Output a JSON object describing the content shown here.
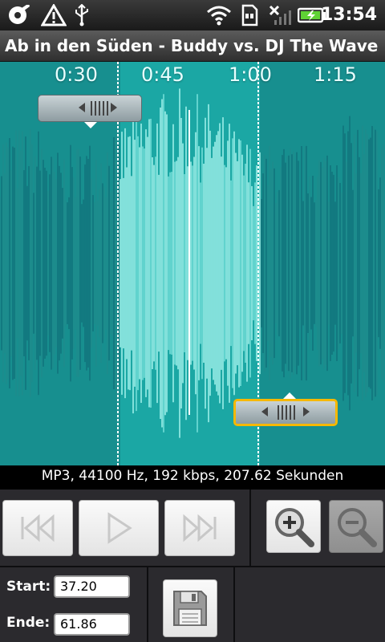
{
  "status_bar": {
    "time": "13:54",
    "icons": [
      "media-icon",
      "warning-icon",
      "usb-icon",
      "wifi-icon",
      "sd-card-icon",
      "no-signal-icon",
      "battery-charging-icon"
    ]
  },
  "title": "Ab in den Süden - Buddy vs. DJ The Wave",
  "timeline": {
    "ticks": [
      "0:30",
      "0:45",
      "1:00",
      "1:15"
    ]
  },
  "info": "MP3, 44100 Hz, 192 kbps, 207.62 Sekunden",
  "controls": {
    "rewind_icon": "rewind-icon",
    "play_icon": "play-icon",
    "fast_forward_icon": "fast-forward-icon",
    "zoom_in_icon": "zoom-in-icon",
    "zoom_out_icon": "zoom-out-icon",
    "save_icon": "save-icon"
  },
  "range": {
    "start_label": "Start:",
    "start_value": "37.20",
    "end_label": "Ende:",
    "end_value": "61.86"
  },
  "colors": {
    "waveform_bg": "#178f8f",
    "selection": "#9ff7f0",
    "highlight_handle": "#f6b800"
  }
}
